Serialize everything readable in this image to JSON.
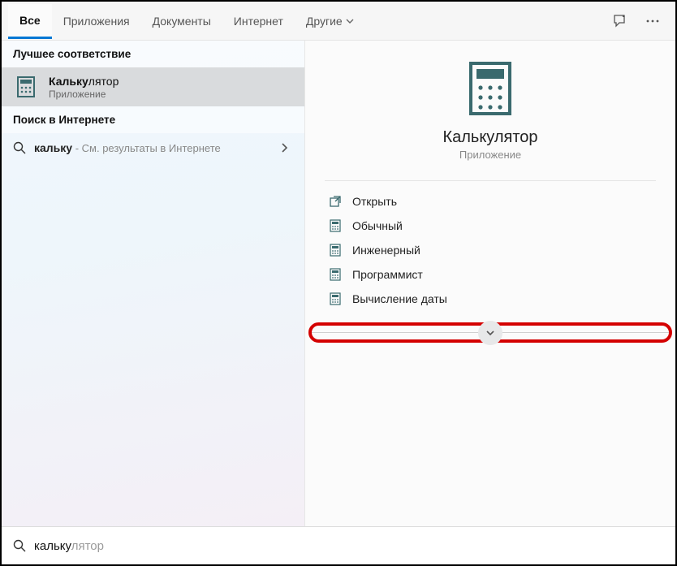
{
  "tabs": {
    "all": "Все",
    "apps": "Приложения",
    "docs": "Документы",
    "web": "Интернет",
    "more": "Другие"
  },
  "left": {
    "best_match": "Лучшее соответствие",
    "calc_bold": "Кальку",
    "calc_rest": "лятор",
    "calc_sub": "Приложение",
    "web_search": "Поиск в Интернете",
    "web_query": "кальку",
    "web_hint": " - См. результаты в Интернете"
  },
  "detail": {
    "title": "Калькулятор",
    "sub": "Приложение",
    "actions": {
      "open": "Открыть",
      "standard": "Обычный",
      "scientific": "Инженерный",
      "programmer": "Программист",
      "date": "Вычисление даты"
    }
  },
  "search": {
    "typed": "кальку",
    "ghost": "лятор"
  }
}
